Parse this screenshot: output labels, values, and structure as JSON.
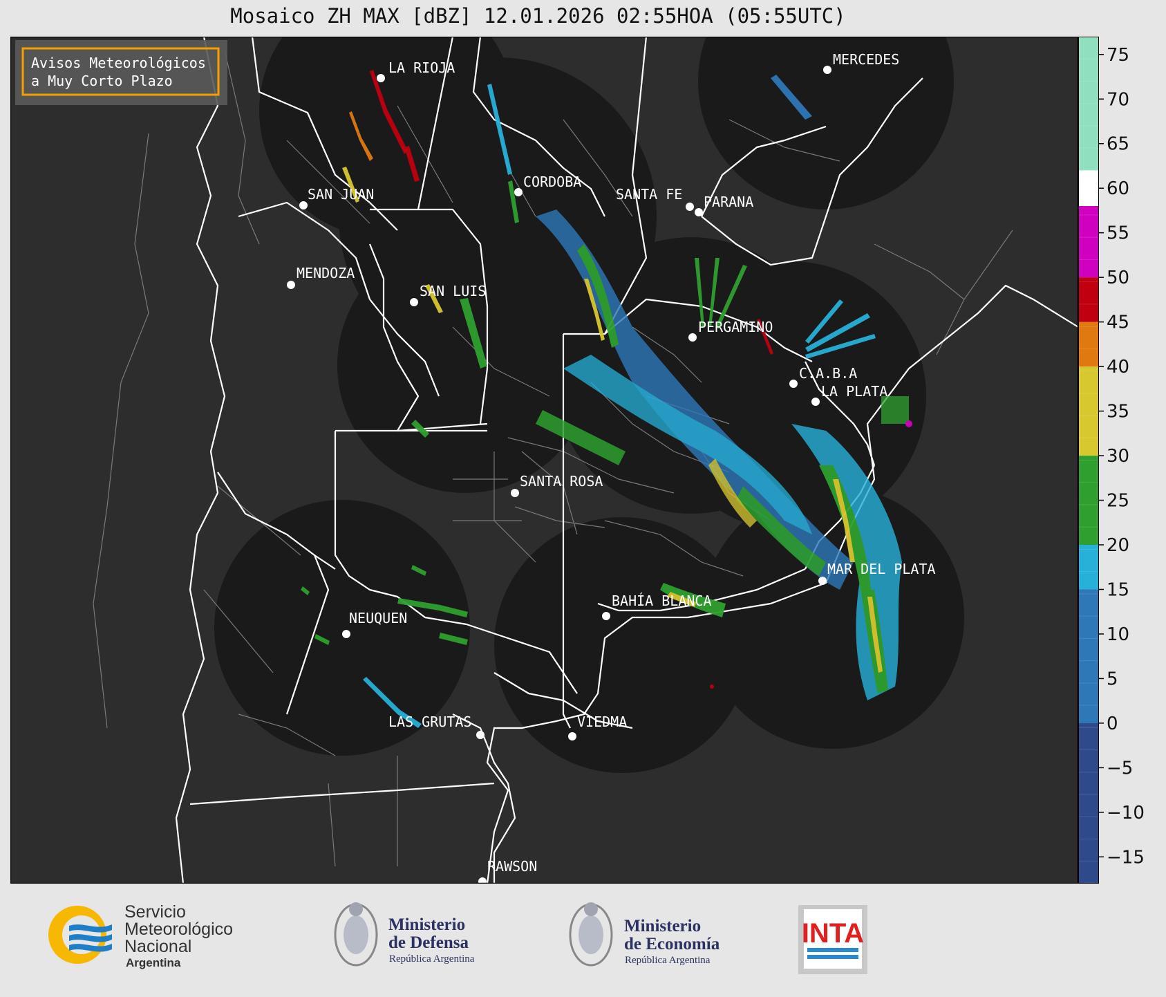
{
  "title": "Mosaico ZH MAX [dBZ] 12.01.2026 02:55HOA (05:55UTC)",
  "legend_box": {
    "line1": "Avisos Meteorológicos",
    "line2": "a Muy Corto Plazo",
    "border_color": "#f5a000"
  },
  "colors": {
    "map_background": "#2d2d2d",
    "radar_disk": "#1a1a1a",
    "borders": "#ffffff",
    "departments": "#7a7a7a"
  },
  "cities": [
    {
      "name": "LA RIOJA"
    },
    {
      "name": "CORDOBA"
    },
    {
      "name": "SAN JUAN"
    },
    {
      "name": "SANTA FE"
    },
    {
      "name": "PARANA"
    },
    {
      "name": "MERCEDES"
    },
    {
      "name": "MENDOZA"
    },
    {
      "name": "SAN LUIS"
    },
    {
      "name": "PERGAMINO"
    },
    {
      "name": "C.A.B.A"
    },
    {
      "name": "LA PLATA"
    },
    {
      "name": "SANTA ROSA"
    },
    {
      "name": "MAR DEL PLATA"
    },
    {
      "name": "BAHÍA BLANCA"
    },
    {
      "name": "NEUQUEN"
    },
    {
      "name": "LAS GRUTAS"
    },
    {
      "name": "VIEDMA"
    },
    {
      "name": "RAWSON"
    }
  ],
  "colorbar": {
    "min": -18,
    "max": 77,
    "ticks": [
      "75",
      "70",
      "65",
      "60",
      "55",
      "50",
      "45",
      "40",
      "35",
      "30",
      "25",
      "20",
      "15",
      "10",
      "5",
      "0",
      "−5",
      "−10",
      "−15"
    ],
    "stops": [
      {
        "from": -18,
        "to": 15,
        "color": "#2f4a8a"
      },
      {
        "from": 0,
        "to": 15,
        "color": "#2f78b8"
      },
      {
        "from": 15,
        "to": 20,
        "color": "#27b0d8"
      },
      {
        "from": 20,
        "to": 30,
        "color": "#2fa02f"
      },
      {
        "from": 30,
        "to": 40,
        "color": "#d8c830"
      },
      {
        "from": 40,
        "to": 45,
        "color": "#e07a10"
      },
      {
        "from": 45,
        "to": 50,
        "color": "#c00010"
      },
      {
        "from": 50,
        "to": 58,
        "color": "#d000c0"
      },
      {
        "from": 58,
        "to": 62,
        "color": "#ffffff"
      },
      {
        "from": 62,
        "to": 77,
        "color": "#90e0c0"
      }
    ]
  },
  "logos": {
    "smn_line1": "Servicio",
    "smn_line2": "Meteorológico",
    "smn_line3": "Nacional",
    "smn_line4": "Argentina",
    "defensa_line1": "Ministerio",
    "defensa_line2": "de Defensa",
    "defensa_line3": "República Argentina",
    "economia_line1": "Ministerio",
    "economia_line2": "de Economía",
    "economia_line3": "República Argentina",
    "inta": "INTA"
  }
}
